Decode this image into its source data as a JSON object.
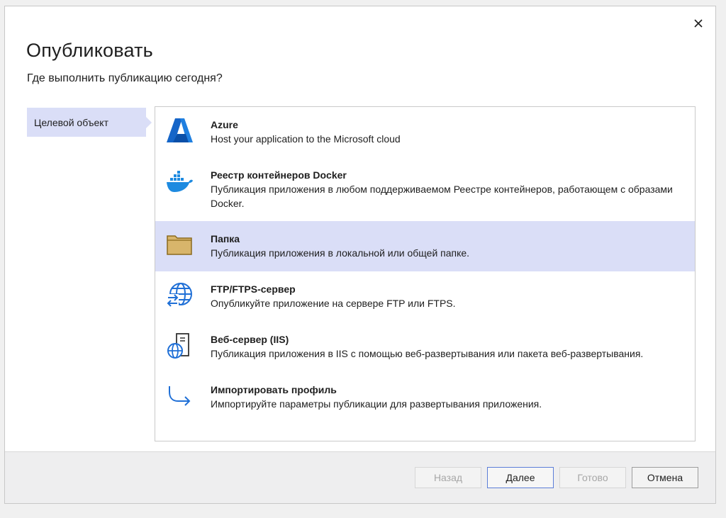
{
  "dialog": {
    "title": "Опубликовать",
    "subtitle": "Где выполнить публикацию сегодня?",
    "close_icon": "close-icon"
  },
  "sidebar": {
    "items": [
      {
        "label": "Целевой объект",
        "selected": true
      }
    ]
  },
  "targets": [
    {
      "name": "Azure",
      "description": "Host your application to the Microsoft cloud",
      "icon": "azure-icon",
      "selected": false
    },
    {
      "name": "Реестр контейнеров Docker",
      "description": "Публикация приложения в любом поддерживаемом Реестре контейнеров, работающем с образами Docker.",
      "icon": "docker-icon",
      "selected": false
    },
    {
      "name": "Папка",
      "description": "Публикация приложения в локальной или общей папке.",
      "icon": "folder-icon",
      "selected": true
    },
    {
      "name": "FTP/FTPS-сервер",
      "description": "Опубликуйте приложение на сервере FTP или FTPS.",
      "icon": "ftp-globe-icon",
      "selected": false
    },
    {
      "name": "Веб-сервер (IIS)",
      "description": "Публикация приложения в IIS с помощью веб-развертывания или пакета веб-развертывания.",
      "icon": "web-server-icon",
      "selected": false
    },
    {
      "name": "Импортировать профиль",
      "description": "Импортируйте параметры публикации для развертывания приложения.",
      "icon": "import-arrow-icon",
      "selected": false
    }
  ],
  "footer": {
    "back_label": "Назад",
    "next_label": "Далее",
    "finish_label": "Готово",
    "cancel_label": "Отмена"
  },
  "colors": {
    "selection": "#dadef7",
    "accent_blue": "#1f6fd6",
    "folder_fill": "#d8b56b"
  }
}
